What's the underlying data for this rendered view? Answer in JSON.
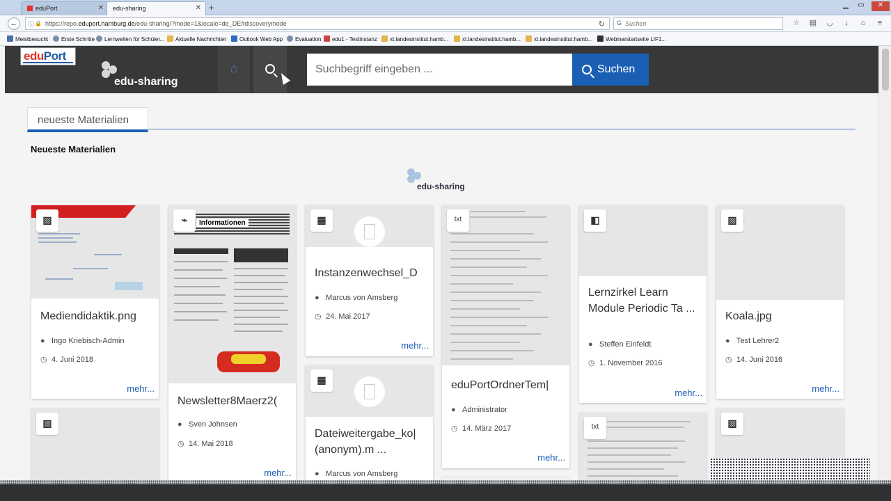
{
  "browser": {
    "tabs": [
      {
        "label": "eduPort"
      },
      {
        "label": "edu-sharing"
      }
    ],
    "url_prefix": "https://repo.",
    "url_host": "eduport.hamburg.de",
    "url_rest": "/edu-sharing/?mode=1&locale=de_DE#discoverymode",
    "search_placeholder": "Suchen",
    "bookmarks": [
      "Meistbesucht",
      "Erste Schritte",
      "Lernwelten für Schüler...",
      "Aktuelle Nachrichten",
      "Outlook Web App",
      "Evaluation",
      "edu1 - Testinstanz",
      "xt.landesinstitut.hamb...",
      "xt.landesinstitut.hamb...",
      "xt.landesinstitut.hamb...",
      "Webinarstartseite LIF1..."
    ]
  },
  "header": {
    "logo_edu": "edu",
    "logo_port": "Port",
    "brand": "edu-sharing",
    "search_placeholder": "Suchbegriff eingeben ...",
    "search_button": "Suchen"
  },
  "tabs": {
    "newest": "neueste Materialien"
  },
  "section_title": "Neueste Materialien",
  "center_logo": "edu-sharing",
  "thumb_text": {
    "newsletter_header": "Informationen",
    "txt_type": "txt"
  },
  "cards": [
    {
      "title": "Mediendidaktik.png",
      "author": "Ingo Kriebisch-Admin",
      "date": "4. Juni 2018",
      "more": "mehr..."
    },
    {
      "title": "Newsletter8Maerz2(",
      "author": "Sven Johnsen",
      "date": "14. Mai 2018",
      "more": "mehr..."
    },
    {
      "title": "Instanzenwechsel_D",
      "author": "Marcus von Amsberg",
      "date": "24. Mai 2017",
      "more": "mehr..."
    },
    {
      "title": "eduPortOrdnerTem|",
      "author": "Administrator",
      "date": "14. März 2017",
      "more": "mehr..."
    },
    {
      "title": "Lernzirkel Learn Module Periodic Ta ...",
      "author": "Steffen Einfeldt",
      "date": "1. November 2016",
      "more": "mehr..."
    },
    {
      "title": "Koala.jpg",
      "author": "Test Lehrer2",
      "date": "14. Juni 2016",
      "more": "mehr..."
    },
    {
      "title": "Dateiweitergabe_ko| (anonym).m ...",
      "author": "Marcus von Amsberg"
    }
  ]
}
